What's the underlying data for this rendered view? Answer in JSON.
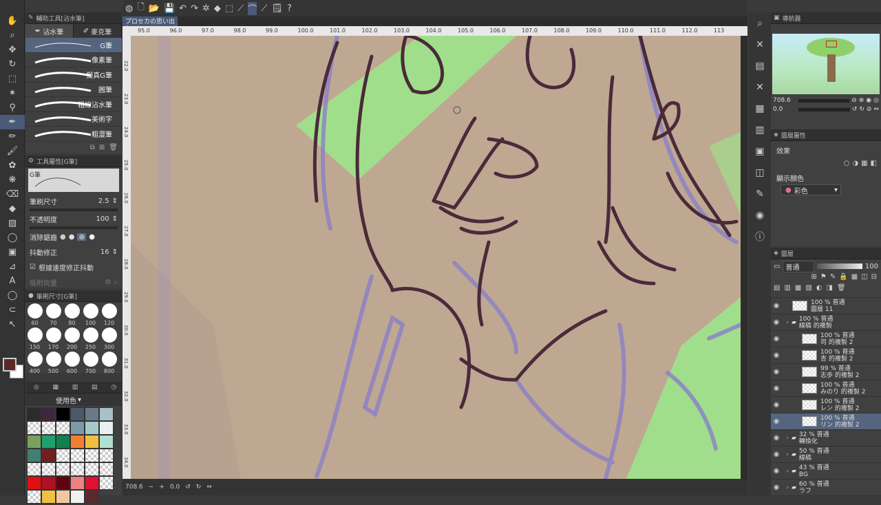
{
  "left_tools": [
    "hand",
    "zoom",
    "move",
    "rotate",
    "select",
    "wand",
    "eyedropper",
    "pen",
    "pencil",
    "brush",
    "airbrush",
    "decoration",
    "eraser",
    "fill",
    "gradient",
    "figure",
    "frame",
    "ruler",
    "text",
    "balloon",
    "lasso",
    "operation"
  ],
  "subtool": {
    "panel_title": "輔助工具[沾水筆]",
    "tabs": [
      "沾水筆",
      "麥克筆"
    ],
    "brushes": [
      "G筆",
      "像素筆",
      "擬真G筆",
      "圓筆",
      "粗線沾水筆",
      "美術字",
      "粗澀筆"
    ],
    "selected": 0
  },
  "tool_property": {
    "panel_title": "工具屬性[G筆]",
    "preset_name": "G筆",
    "brush_size_label": "筆刷尺寸",
    "brush_size_value": "2.5",
    "opacity_label": "不透明度",
    "opacity_value": "100",
    "aa_label": "消除鋸齒",
    "stabilize_label": "抖動修正",
    "stabilize_value": "16",
    "speed_label": "根據速度修正抖動",
    "extra_label": "吸附向量"
  },
  "brush_size_panel": {
    "title": "筆刷尺寸[G筆]",
    "sizes": [
      "60",
      "70",
      "80",
      "100",
      "120",
      "150",
      "170",
      "200",
      "250",
      "300",
      "400",
      "500",
      "600",
      "700",
      "800"
    ]
  },
  "colorset": {
    "name": "使用色",
    "swatches": [
      "#2b2b2b",
      "#3c2a3c",
      "#000000",
      "#4a5a6a",
      "#6a7a8a",
      "#a8c0c8",
      "#chk",
      "#chk",
      "#chk",
      "#7a9aa8",
      "#a8c8c8",
      "#e8f0f0",
      "#7aa060",
      "#20a070",
      "#108050",
      "#f08030",
      "#f0c040",
      "#b0e0d0",
      "#408070",
      "#702020",
      "#chk",
      "#chk",
      "#chk",
      "#chk",
      "#chk",
      "#chk",
      "#chk",
      "#chk",
      "#chk",
      "#chk",
      "#e01010",
      "#b01020",
      "#600010",
      "#f08080",
      "#e01030",
      "#chk",
      "#chk",
      "#f0c040",
      "#f0c8a0",
      "#f0f0f0",
      "#5a2a2a"
    ],
    "main_color": "#5a2a2a",
    "sub_color": "#ffffff"
  },
  "command_bar": {
    "icons": [
      "clip-logo",
      "new",
      "open",
      "save",
      "undo",
      "redo",
      "loading",
      "fill",
      "transform",
      "snap-line",
      "snap-curve",
      "snap-special",
      "history",
      "help"
    ]
  },
  "document": {
    "tab_title": "プロセカの思い出1"
  },
  "ruler": {
    "top_ticks": [
      "95.0",
      "96.0",
      "97.0",
      "98.0",
      "99.0",
      "100.0",
      "101.0",
      "102.0",
      "103.0",
      "104.0",
      "105.0",
      "106.0",
      "107.0",
      "108.0",
      "109.0",
      "110.0",
      "111.0",
      "112.0",
      "113"
    ],
    "left_ticks": [
      "22.0",
      "23.0",
      "24.0",
      "25.0",
      "26.0",
      "27.0",
      "28.0",
      "29.0",
      "30.0",
      "31.0",
      "32.0",
      "33.0",
      "34.0"
    ]
  },
  "status": {
    "zoom": "708.6",
    "angle": "0.0"
  },
  "navigator": {
    "title": "導航器",
    "zoom": "708.6",
    "angle": "0.0"
  },
  "layer_property": {
    "title": "圖層屬性",
    "effect_label": "效果",
    "display_color_label": "顯示顏色",
    "display_color_value": "彩色"
  },
  "layers_panel": {
    "title": "圖層",
    "blend_mode": "普通",
    "opacity": "100",
    "layers": [
      {
        "line1": "100 % 普通",
        "line2": "圖層 11",
        "indent": 0,
        "folder": false,
        "sel": false
      },
      {
        "line1": "100 % 普通",
        "line2": "線稿 的複製",
        "indent": 0,
        "folder": true,
        "sel": false
      },
      {
        "line1": "100 % 普通",
        "line2": "司 的複製 2",
        "indent": 1,
        "folder": false,
        "sel": false
      },
      {
        "line1": "100 % 普通",
        "line2": "杏 的複製 2",
        "indent": 1,
        "folder": false,
        "sel": false
      },
      {
        "line1": "99 % 普通",
        "line2": "志歩 的複製 2",
        "indent": 1,
        "folder": false,
        "sel": false
      },
      {
        "line1": "100 % 普通",
        "line2": "みのり 的複製 2",
        "indent": 1,
        "folder": false,
        "sel": false
      },
      {
        "line1": "100 % 普通",
        "line2": "レン 的複製 2",
        "indent": 1,
        "folder": false,
        "sel": false
      },
      {
        "line1": "100 % 普通",
        "line2": "リン 的複製 2",
        "indent": 1,
        "folder": false,
        "sel": true
      },
      {
        "line1": "32 % 普通",
        "line2": "轉換化",
        "indent": 0,
        "folder": true,
        "sel": false
      },
      {
        "line1": "50 % 普通",
        "line2": "線稿",
        "indent": 0,
        "folder": true,
        "sel": false
      },
      {
        "line1": "43 % 普通",
        "line2": "BG",
        "indent": 0,
        "folder": true,
        "sel": false
      },
      {
        "line1": "60 % 普通",
        "line2": "ラフ",
        "indent": 0,
        "folder": true,
        "sel": false
      }
    ]
  }
}
